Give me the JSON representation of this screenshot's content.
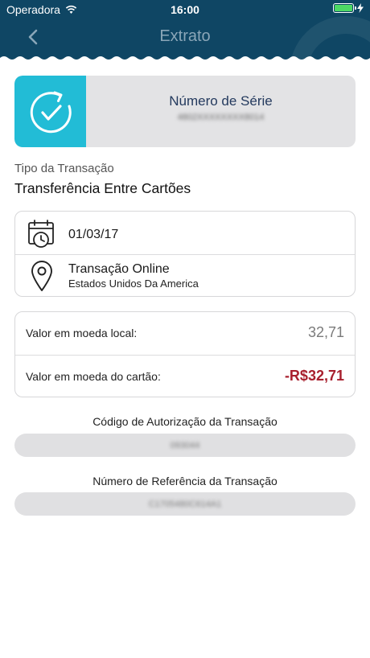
{
  "status_bar": {
    "carrier": "Operadora",
    "time": "16:00"
  },
  "nav": {
    "title": "Extrato"
  },
  "serial": {
    "label": "Número de Série",
    "value": "4802XXXXXXXX8014"
  },
  "transaction_type": {
    "label": "Tipo da Transação",
    "value": "Transferência Entre Cartões"
  },
  "details": {
    "date": "01/03/17",
    "location_title": "Transação Online",
    "location_country": "Estados Unidos Da America"
  },
  "values": {
    "local_label": "Valor em moeda local:",
    "local_amount": "32,71",
    "card_label": "Valor em moeda do cartão:",
    "card_amount": "-R$32,71"
  },
  "authorization": {
    "title": "Código de Autorização da Transação",
    "value": "093044"
  },
  "reference": {
    "title": "Número de Referência da Transação",
    "value": "C1705480C614A1"
  },
  "colors": {
    "header": "#0f4664",
    "accent": "#22bcd6",
    "negative": "#a8202e"
  }
}
